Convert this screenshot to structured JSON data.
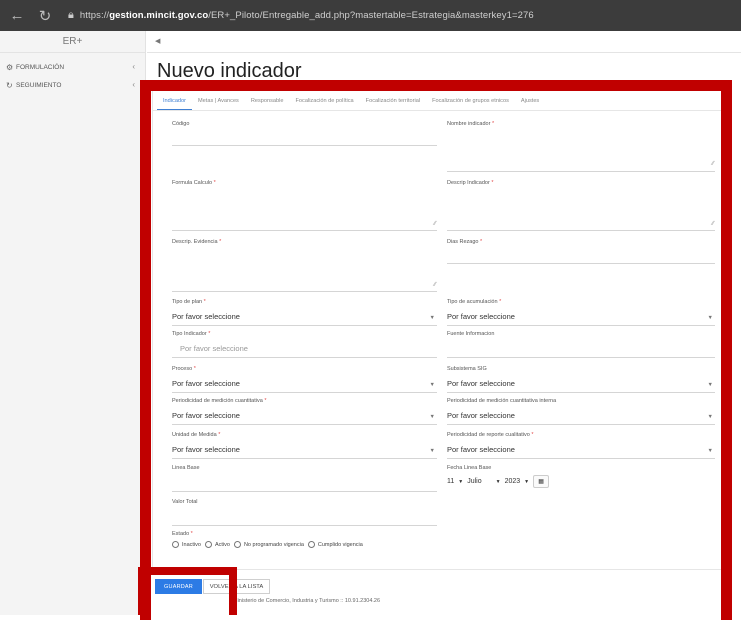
{
  "browser": {
    "url_prefix": "https://",
    "url_host": "gestion.mincit.gov.co",
    "url_path": "/ER+_Piloto/Entregable_add.php?mastertable=Estrategia&masterkey1=276"
  },
  "sidebar": {
    "brand": "ER+",
    "items": [
      {
        "label": "FORMULACIÓN",
        "icon": "gear-icon"
      },
      {
        "label": "SEGUIMIENTO",
        "icon": "refresh-icon"
      }
    ]
  },
  "page": {
    "title": "Nuevo indicador"
  },
  "tabs": [
    "Indicador",
    "Metas | Avances",
    "Responsable",
    "Focalización de política",
    "Focalización territorial",
    "Focalización de grupos etnicos",
    "Ajustes"
  ],
  "form": {
    "codigo": "Código",
    "nombre_indicador": "Nombre indicador",
    "formula_calculo": "Formula Calculo",
    "descrip_indicador": "Descrip Indicador",
    "descrip_evidencia": "Descrip. Evidencia",
    "dias_rezago": "Dias Rezago",
    "tipo_plan": "Tipo de plan",
    "tipo_acumulacion": "Tipo de acumulación",
    "tipo_indicador": "Tipo Indicador",
    "fuente_informacion": "Fuente Informacion",
    "proceso": "Proceso",
    "subsistema_sig": "Subsistema SIG",
    "periodicidad_cuantitativa": "Periodicidad de medición cuantitativa",
    "periodicidad_cuantitativa_interna": "Periodicidad de medición cuantitativa interna",
    "unidad_medida": "Unidad de Medida",
    "periodicidad_reporte_cualitativo": "Periodicidad de reporte cualitativo",
    "linea_base": "Linea Base",
    "fecha_linea_base": "Fecha Linea Base",
    "valor_total": "Valor Total",
    "estado": "Estado",
    "placeholder": "Por favor seleccione",
    "required_mark": "*",
    "date_day": "11",
    "date_month": "Julio",
    "date_year": "2023",
    "estado_options": [
      "Inactivo",
      "Activo",
      "No programado vigencia",
      "Cumplido vigencia"
    ]
  },
  "buttons": {
    "save": "GUARDAR",
    "back": "VOLVER A LA LISTA"
  },
  "footer": "Ministerio de Comercio, Industria y Turismo :: 10.91.2304.26"
}
